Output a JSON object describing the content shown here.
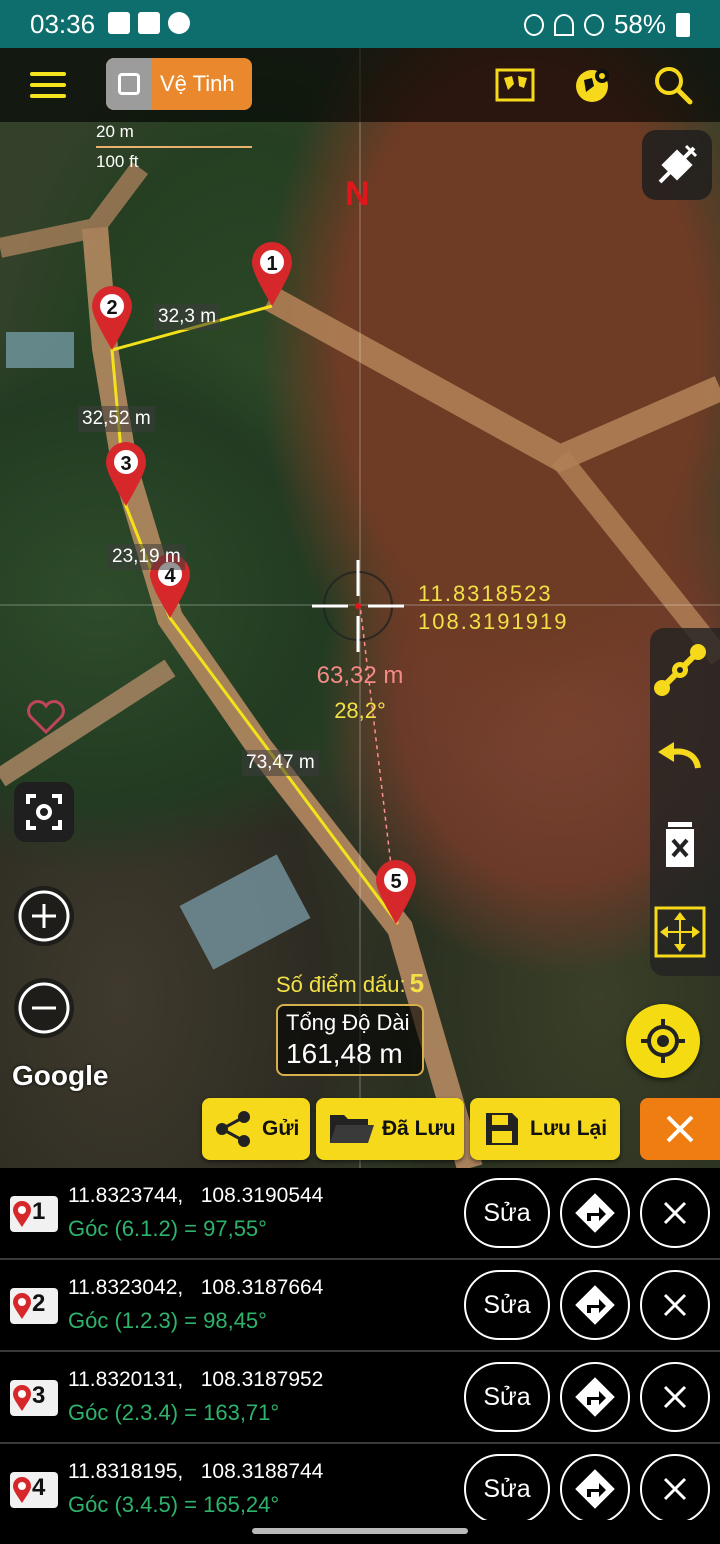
{
  "status_bar": {
    "time": "03:36",
    "battery": "58%"
  },
  "toolbar": {
    "map_type_label": "Vệ Tinh",
    "icons": [
      "menu-icon",
      "world-map-icon",
      "globe-pin-icon",
      "search-icon"
    ]
  },
  "map": {
    "scale_metric": "20 m",
    "scale_imperial": "100 ft",
    "north_label": "N",
    "segment_labels": [
      "32,3 m",
      "32,52 m",
      "23,19 m",
      "73,47 m"
    ],
    "markers": [
      "1",
      "2",
      "3",
      "4",
      "5"
    ],
    "crosshair_lat": "11.8318523",
    "crosshair_lng": "108.3191919",
    "crosshair_distance": "63,32 m",
    "crosshair_angle": "28,2°",
    "attribution": "Google",
    "marker_count_label": "Số điểm dấu:",
    "marker_count": "5",
    "total_label": "Tổng Độ Dài",
    "total_value": "161,48 m"
  },
  "actions": {
    "send": "Gửi",
    "saved": "Đã Lưu",
    "save": "Lưu Lại"
  },
  "points": [
    {
      "index": "1",
      "coords": "11.8323744,   108.3190544",
      "angle": "Góc (6.1.2) = 97,55°",
      "edit": "Sửa"
    },
    {
      "index": "2",
      "coords": "11.8323042,   108.3187664",
      "angle": "Góc (1.2.3) = 98,45°",
      "edit": "Sửa"
    },
    {
      "index": "3",
      "coords": "11.8320131,   108.3187952",
      "angle": "Góc (2.3.4) = 163,71°",
      "edit": "Sửa"
    },
    {
      "index": "4",
      "coords": "11.8318195,   108.3188744",
      "angle": "Góc (3.4.5) = 165,24°",
      "edit": "Sửa"
    }
  ],
  "colors": {
    "accent_yellow": "#f6d91b",
    "orange": "#ef7d12",
    "angle_green": "#2fb36c",
    "marker_red": "#e0161a"
  }
}
